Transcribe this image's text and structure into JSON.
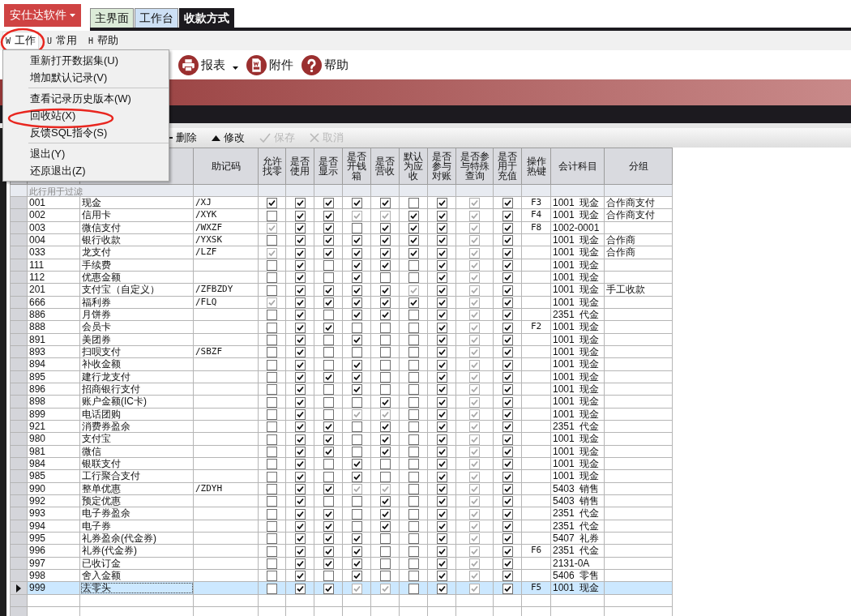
{
  "logo_button": {
    "label": "安仕达软件"
  },
  "tabs": [
    {
      "label": "主界面",
      "selected": false,
      "color": "#dcebd8"
    },
    {
      "label": "工作台",
      "selected": false,
      "color": "#cde0f5"
    },
    {
      "label": "收款方式",
      "selected": true,
      "color": "#1c1a1f"
    }
  ],
  "menu_bar": [
    {
      "key": "W",
      "label": "工作",
      "open": true
    },
    {
      "key": "U",
      "label": "常用",
      "open": false
    },
    {
      "key": "H",
      "label": "帮助",
      "open": false
    }
  ],
  "dropdown_menu": {
    "groups": [
      {
        "items": [
          "重新打开数据集(U)",
          "增加默认记录(V)"
        ]
      },
      {
        "items": [
          "查看记录历史版本(W)",
          "回收站(X)",
          "反馈SQL指令(S)"
        ]
      },
      {
        "items": [
          "退出(Y)",
          "还原退出(Z)"
        ]
      }
    ]
  },
  "toolbar": [
    {
      "label": "报表",
      "kind": "print",
      "dropdown": true
    },
    {
      "label": "附件",
      "kind": "attach",
      "dropdown": false
    },
    {
      "label": "帮助",
      "kind": "help",
      "dropdown": false
    }
  ],
  "grid_toolbar": [
    {
      "label": "删除",
      "kind": "delete",
      "disabled": false
    },
    {
      "label": "修改",
      "kind": "edit",
      "disabled": false
    },
    {
      "label": "保存",
      "kind": "save",
      "disabled": true
    },
    {
      "label": "取消",
      "kind": "cancel",
      "disabled": true
    }
  ],
  "table": {
    "columns": [
      "助记码",
      "允许找零",
      "是否使用",
      "是否显示",
      "是否开钱箱",
      "是否营收",
      "默认为应收",
      "是否参与对账",
      "是否参与特殊查询",
      "是否用于充值",
      "操作热键",
      "会计科目",
      "分组"
    ],
    "filter_hint": "此行用于过滤",
    "rows": [
      {
        "code": "001",
        "name": "现金",
        "mnemonic": "/XJ",
        "checked": [
          true,
          true,
          true,
          true,
          true,
          false,
          true,
          true,
          true
        ],
        "disabled": [
          false,
          false,
          false,
          false,
          false,
          false,
          false,
          true,
          false
        ],
        "hotkey": "F3",
        "account": "1001  现金",
        "group": "合作商支付",
        "selected": false
      },
      {
        "code": "002",
        "name": "信用卡",
        "mnemonic": "/XYK",
        "checked": [
          false,
          true,
          true,
          true,
          true,
          true,
          true,
          true,
          true
        ],
        "disabled": [
          false,
          false,
          false,
          true,
          true,
          false,
          false,
          true,
          false
        ],
        "hotkey": "F4",
        "account": "1001  现金",
        "group": "合作商支付",
        "selected": false
      },
      {
        "code": "003",
        "name": "微信支付",
        "mnemonic": "/WXZF",
        "checked": [
          true,
          true,
          true,
          false,
          true,
          true,
          true,
          true,
          true
        ],
        "disabled": [
          true,
          false,
          false,
          false,
          false,
          false,
          false,
          true,
          false
        ],
        "hotkey": "F8",
        "account": "1002-0001",
        "selected": false
      },
      {
        "code": "004",
        "name": "银行收款",
        "mnemonic": "/YXSK",
        "checked": [
          false,
          true,
          true,
          true,
          true,
          true,
          true,
          true,
          true
        ],
        "disabled": [
          false,
          false,
          false,
          false,
          false,
          false,
          false,
          true,
          false
        ],
        "account": "1001  现金",
        "group": "合作商",
        "selected": false
      },
      {
        "code": "033",
        "name": "龙支付",
        "mnemonic": "/LZF",
        "checked": [
          true,
          true,
          true,
          true,
          true,
          true,
          true,
          true,
          true
        ],
        "disabled": [
          true,
          false,
          false,
          false,
          false,
          false,
          false,
          true,
          false
        ],
        "account": "1001  现金",
        "group": "合作商",
        "selected": false
      },
      {
        "code": "111",
        "name": "手续费",
        "checked": [
          false,
          true,
          false,
          true,
          true,
          false,
          true,
          true,
          true
        ],
        "disabled": [
          false,
          false,
          false,
          false,
          false,
          false,
          false,
          true,
          false
        ],
        "account": "1001  现金",
        "selected": false
      },
      {
        "code": "112",
        "name": "优惠金额",
        "checked": [
          false,
          true,
          false,
          true,
          false,
          false,
          true,
          true,
          true
        ],
        "disabled": [
          false,
          false,
          false,
          false,
          false,
          false,
          false,
          true,
          false
        ],
        "account": "1001  现金",
        "selected": false
      },
      {
        "code": "201",
        "name": "支付宝（自定义）",
        "mnemonic": "/ZFBZDY",
        "checked": [
          false,
          true,
          true,
          true,
          true,
          true,
          true,
          true,
          true
        ],
        "disabled": [
          false,
          false,
          false,
          false,
          false,
          true,
          false,
          true,
          false
        ],
        "account": "1001  现金",
        "group": "手工收款",
        "selected": false
      },
      {
        "code": "666",
        "name": "福利券",
        "mnemonic": "/FLQ",
        "checked": [
          true,
          true,
          true,
          true,
          true,
          true,
          true,
          true,
          true
        ],
        "disabled": [
          true,
          false,
          false,
          false,
          false,
          false,
          false,
          true,
          false
        ],
        "account": "1001  现金",
        "selected": false
      },
      {
        "code": "886",
        "name": "月饼券",
        "checked": [
          false,
          true,
          false,
          true,
          true,
          false,
          true,
          true,
          true
        ],
        "disabled": [
          false,
          false,
          false,
          false,
          false,
          false,
          false,
          true,
          false
        ],
        "account": "2351  代金",
        "selected": false
      },
      {
        "code": "888",
        "name": "会员卡",
        "checked": [
          false,
          true,
          true,
          false,
          false,
          false,
          true,
          true,
          true
        ],
        "disabled": [
          false,
          false,
          false,
          false,
          false,
          false,
          false,
          true,
          false
        ],
        "hotkey": "F2",
        "account": "1001  现金",
        "selected": false
      },
      {
        "code": "891",
        "name": "美团券",
        "checked": [
          false,
          true,
          false,
          true,
          false,
          false,
          true,
          true,
          true
        ],
        "disabled": [
          false,
          false,
          false,
          false,
          false,
          false,
          false,
          true,
          false
        ],
        "account": "1001  现金",
        "selected": false
      },
      {
        "code": "893",
        "name": "扫呗支付",
        "mnemonic": "/SBZF",
        "checked": [
          false,
          true,
          false,
          false,
          false,
          false,
          true,
          true,
          true
        ],
        "disabled": [
          false,
          false,
          false,
          false,
          false,
          false,
          false,
          true,
          false
        ],
        "account": "1001  现金",
        "selected": false
      },
      {
        "code": "894",
        "name": "补收金额",
        "checked": [
          false,
          true,
          false,
          true,
          false,
          false,
          true,
          true,
          true
        ],
        "disabled": [
          false,
          false,
          false,
          false,
          false,
          false,
          false,
          true,
          false
        ],
        "account": "1001  现金",
        "selected": false
      },
      {
        "code": "895",
        "name": "建行龙支付",
        "checked": [
          false,
          true,
          true,
          true,
          false,
          false,
          true,
          true,
          true
        ],
        "disabled": [
          false,
          false,
          false,
          false,
          false,
          false,
          false,
          true,
          false
        ],
        "account": "1001  现金",
        "selected": false
      },
      {
        "code": "896",
        "name": "招商银行支付",
        "checked": [
          false,
          true,
          false,
          true,
          false,
          false,
          true,
          true,
          true
        ],
        "disabled": [
          false,
          false,
          false,
          false,
          false,
          false,
          false,
          true,
          false
        ],
        "account": "1001  现金",
        "selected": false
      },
      {
        "code": "898",
        "name": "账户金额(IC卡)",
        "checked": [
          false,
          true,
          false,
          false,
          true,
          false,
          true,
          true,
          true
        ],
        "disabled": [
          false,
          false,
          false,
          false,
          false,
          false,
          false,
          true,
          false
        ],
        "account": "1001  现金",
        "selected": false
      },
      {
        "code": "899",
        "name": "电话团购",
        "checked": [
          false,
          true,
          false,
          true,
          true,
          false,
          true,
          true,
          true
        ],
        "disabled": [
          false,
          false,
          false,
          true,
          true,
          false,
          false,
          true,
          false
        ],
        "account": "1001  现金",
        "selected": false
      },
      {
        "code": "921",
        "name": "消费券盈余",
        "checked": [
          false,
          true,
          true,
          false,
          true,
          false,
          true,
          true,
          true
        ],
        "disabled": [
          false,
          false,
          false,
          false,
          false,
          false,
          false,
          true,
          false
        ],
        "account": "2351  代金",
        "selected": false
      },
      {
        "code": "980",
        "name": "支付宝",
        "checked": [
          false,
          true,
          true,
          false,
          true,
          false,
          true,
          true,
          true
        ],
        "disabled": [
          false,
          false,
          false,
          false,
          false,
          false,
          false,
          true,
          false
        ],
        "account": "1001  现金",
        "selected": false
      },
      {
        "code": "981",
        "name": "微信",
        "checked": [
          false,
          true,
          true,
          false,
          true,
          false,
          true,
          true,
          true
        ],
        "disabled": [
          false,
          false,
          false,
          false,
          false,
          false,
          false,
          true,
          false
        ],
        "account": "1001  现金",
        "selected": false
      },
      {
        "code": "984",
        "name": "银联支付",
        "checked": [
          false,
          true,
          false,
          true,
          false,
          false,
          true,
          true,
          true
        ],
        "disabled": [
          false,
          false,
          false,
          false,
          false,
          false,
          false,
          true,
          false
        ],
        "account": "1001  现金",
        "selected": false
      },
      {
        "code": "985",
        "name": "工行聚合支付",
        "checked": [
          false,
          true,
          false,
          true,
          false,
          false,
          true,
          true,
          true
        ],
        "disabled": [
          false,
          false,
          false,
          false,
          false,
          false,
          false,
          true,
          false
        ],
        "account": "1001  现金",
        "selected": false
      },
      {
        "code": "990",
        "name": "整单优惠",
        "mnemonic": "/ZDYH",
        "checked": [
          false,
          true,
          true,
          true,
          true,
          false,
          true,
          true,
          true
        ],
        "disabled": [
          false,
          false,
          false,
          true,
          true,
          false,
          false,
          true,
          false
        ],
        "account": "5403  销售",
        "selected": false
      },
      {
        "code": "992",
        "name": "预定优惠",
        "checked": [
          false,
          true,
          false,
          false,
          true,
          false,
          true,
          true,
          true
        ],
        "disabled": [
          false,
          false,
          false,
          false,
          false,
          false,
          false,
          true,
          false
        ],
        "account": "5403  销售",
        "selected": false
      },
      {
        "code": "993",
        "name": "电子券盈余",
        "checked": [
          false,
          true,
          true,
          false,
          true,
          false,
          true,
          true,
          true
        ],
        "disabled": [
          false,
          false,
          false,
          false,
          false,
          false,
          false,
          true,
          false
        ],
        "account": "2351  代金",
        "selected": false
      },
      {
        "code": "994",
        "name": "电子券",
        "checked": [
          false,
          true,
          true,
          false,
          true,
          false,
          true,
          true,
          true
        ],
        "disabled": [
          false,
          false,
          false,
          false,
          false,
          false,
          false,
          true,
          false
        ],
        "account": "2351  代金",
        "selected": false
      },
      {
        "code": "995",
        "name": "礼券盈余(代金券)",
        "checked": [
          false,
          true,
          true,
          true,
          false,
          false,
          true,
          true,
          true
        ],
        "disabled": [
          false,
          false,
          false,
          false,
          false,
          false,
          false,
          true,
          false
        ],
        "account": "5407  礼券",
        "selected": false
      },
      {
        "code": "996",
        "name": "礼券(代金券)",
        "checked": [
          false,
          true,
          true,
          true,
          false,
          false,
          true,
          true,
          true
        ],
        "disabled": [
          false,
          false,
          false,
          false,
          false,
          false,
          false,
          true,
          false
        ],
        "hotkey": "F6",
        "account": "2351  代金",
        "selected": false
      },
      {
        "code": "997",
        "name": "已收订金",
        "checked": [
          false,
          true,
          true,
          true,
          false,
          false,
          true,
          true,
          true
        ],
        "disabled": [
          false,
          false,
          false,
          false,
          false,
          false,
          false,
          true,
          false
        ],
        "account": "2131-0A",
        "selected": false
      },
      {
        "code": "998",
        "name": "舍入金额",
        "checked": [
          false,
          true,
          false,
          true,
          false,
          false,
          true,
          true,
          true
        ],
        "disabled": [
          false,
          false,
          false,
          false,
          false,
          false,
          false,
          true,
          false
        ],
        "account": "5406  零售",
        "selected": false
      },
      {
        "code": "999",
        "name": "去零头",
        "checked": [
          false,
          true,
          true,
          true,
          true,
          false,
          true,
          true,
          true
        ],
        "disabled": [
          false,
          false,
          false,
          true,
          true,
          false,
          false,
          true,
          false
        ],
        "hotkey": "F5",
        "account": "1001  现金",
        "selected": true
      }
    ]
  }
}
